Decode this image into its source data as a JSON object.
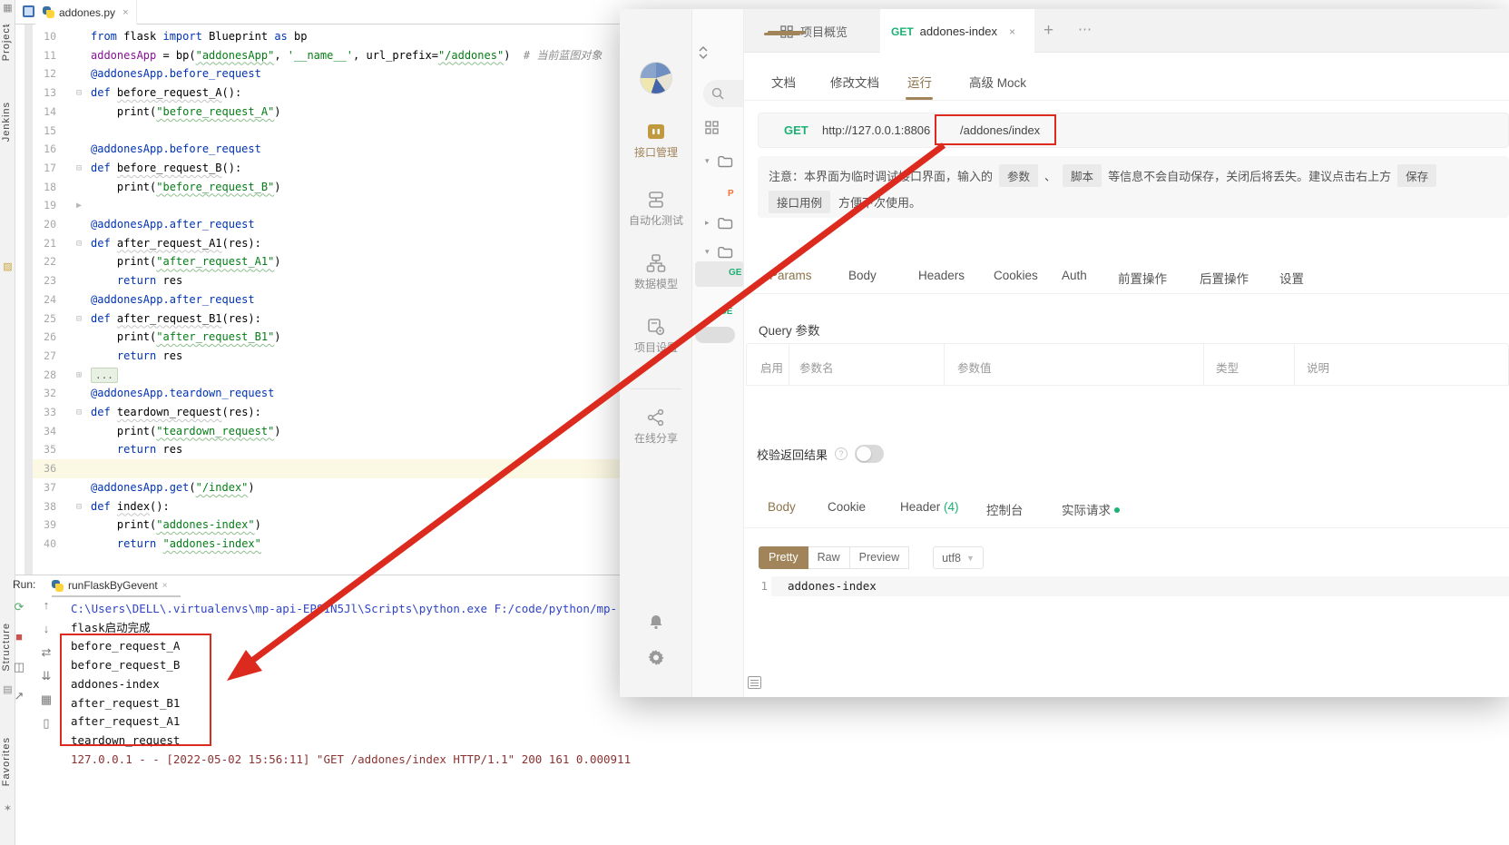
{
  "theme": {
    "accent": "#A2845A",
    "method_green": "#1CB273",
    "annotation_red": "#DC2A1E"
  },
  "ide": {
    "stripe_labels": [
      "Project",
      "Jenkins",
      "Structure",
      "Favorites"
    ],
    "editor_tab": {
      "title": "addones.py",
      "close": "×"
    },
    "code": {
      "current_line": 36,
      "lines": [
        {
          "n": 10,
          "t": [
            [
              "k",
              "from"
            ],
            [
              "t",
              " flask "
            ],
            [
              "k",
              "import"
            ],
            [
              "t",
              " Blueprint "
            ],
            [
              "k",
              "as"
            ],
            [
              "t",
              " bp"
            ]
          ]
        },
        {
          "n": 11,
          "t": [
            [
              "v",
              "addonesApp"
            ],
            [
              "t",
              " = bp("
            ],
            [
              "u",
              "\"addonesApp\""
            ],
            [
              "t",
              ", "
            ],
            [
              "s",
              "'__name__'"
            ],
            [
              "t",
              ", url_prefix="
            ],
            [
              "u",
              "\"/addones\""
            ],
            [
              "t",
              ")  "
            ],
            [
              "c",
              "# 当前蓝图对象"
            ]
          ]
        },
        {
          "n": 12,
          "t": [
            [
              "k",
              "@addonesApp.before_request"
            ]
          ]
        },
        {
          "n": 13,
          "m": "⊟",
          "t": [
            [
              "k",
              "def"
            ],
            [
              "t",
              " "
            ],
            [
              "w",
              "before_request_A"
            ],
            [
              "t",
              "():"
            ]
          ]
        },
        {
          "n": 14,
          "t": [
            [
              "t",
              "    print("
            ],
            [
              "u",
              "\"before_request_A\""
            ],
            [
              "t",
              ")"
            ]
          ]
        },
        {
          "n": 15,
          "t": []
        },
        {
          "n": 16,
          "t": [
            [
              "k",
              "@addonesApp.before_request"
            ]
          ]
        },
        {
          "n": 17,
          "m": "⊟",
          "t": [
            [
              "k",
              "def"
            ],
            [
              "t",
              " "
            ],
            [
              "w",
              "before_request_B"
            ],
            [
              "t",
              "():"
            ]
          ]
        },
        {
          "n": 18,
          "t": [
            [
              "t",
              "    print("
            ],
            [
              "u",
              "\"before_request_B\""
            ],
            [
              "t",
              ")"
            ]
          ]
        },
        {
          "n": 19,
          "m": "▶",
          "t": []
        },
        {
          "n": 20,
          "t": [
            [
              "k",
              "@addonesApp.after_request"
            ]
          ]
        },
        {
          "n": 21,
          "m": "⊟",
          "t": [
            [
              "k",
              "def"
            ],
            [
              "t",
              " "
            ],
            [
              "w",
              "after_request_A1"
            ],
            [
              "t",
              "(res):"
            ]
          ]
        },
        {
          "n": 22,
          "t": [
            [
              "t",
              "    print("
            ],
            [
              "u",
              "\"after_request_A1\""
            ],
            [
              "t",
              ")"
            ]
          ]
        },
        {
          "n": 23,
          "t": [
            [
              "t",
              "    "
            ],
            [
              "k",
              "return"
            ],
            [
              "t",
              " res"
            ]
          ]
        },
        {
          "n": 24,
          "t": [
            [
              "k",
              "@addonesApp.after_request"
            ]
          ]
        },
        {
          "n": 25,
          "m": "⊟",
          "t": [
            [
              "k",
              "def"
            ],
            [
              "t",
              " "
            ],
            [
              "w",
              "after_request_B1"
            ],
            [
              "t",
              "(res):"
            ]
          ]
        },
        {
          "n": 26,
          "t": [
            [
              "t",
              "    print("
            ],
            [
              "u",
              "\"after_request_B1\""
            ],
            [
              "t",
              ")"
            ]
          ]
        },
        {
          "n": 27,
          "t": [
            [
              "t",
              "    "
            ],
            [
              "k",
              "return"
            ],
            [
              "t",
              " res"
            ]
          ]
        },
        {
          "n": 28,
          "m": "⊞",
          "t": [
            [
              "f",
              "..."
            ]
          ]
        },
        {
          "n": 32,
          "t": [
            [
              "k",
              "@addonesApp.teardown_request"
            ]
          ]
        },
        {
          "n": 33,
          "m": "⊟",
          "t": [
            [
              "k",
              "def"
            ],
            [
              "t",
              " "
            ],
            [
              "w",
              "teardown_request"
            ],
            [
              "t",
              "(res):"
            ]
          ]
        },
        {
          "n": 34,
          "t": [
            [
              "t",
              "    print("
            ],
            [
              "u",
              "\"teardown_request\""
            ],
            [
              "t",
              ")"
            ]
          ]
        },
        {
          "n": 35,
          "t": [
            [
              "t",
              "    "
            ],
            [
              "k",
              "return"
            ],
            [
              "t",
              " res"
            ]
          ]
        },
        {
          "n": 36,
          "t": []
        },
        {
          "n": 37,
          "t": [
            [
              "k",
              "@addonesApp.get"
            ],
            [
              "t",
              "("
            ],
            [
              "u",
              "\"/index\""
            ],
            [
              "t",
              ")"
            ]
          ]
        },
        {
          "n": 38,
          "m": "⊟",
          "t": [
            [
              "k",
              "def"
            ],
            [
              "t",
              " "
            ],
            [
              "w",
              "index"
            ],
            [
              "t",
              "():"
            ]
          ]
        },
        {
          "n": 39,
          "t": [
            [
              "t",
              "    print("
            ],
            [
              "u",
              "\"addones-index\""
            ],
            [
              "t",
              ")"
            ]
          ]
        },
        {
          "n": 40,
          "t": [
            [
              "t",
              "    "
            ],
            [
              "k",
              "return"
            ],
            [
              "t",
              " "
            ],
            [
              "u",
              "\"addones-index\""
            ]
          ]
        }
      ]
    },
    "run": {
      "label": "Run:",
      "tab": {
        "title": "runFlaskByGevent",
        "close": "×"
      },
      "console": [
        {
          "c": "sys",
          "t": "C:\\Users\\DELL\\.virtualenvs\\mp-api-EP81N5Jl\\Scripts\\python.exe F:/code/python/mp-"
        },
        {
          "c": "out",
          "t": "flask启动完成"
        },
        {
          "c": "out",
          "t": "before_request_A"
        },
        {
          "c": "out",
          "t": "before_request_B"
        },
        {
          "c": "out",
          "t": "addones-index"
        },
        {
          "c": "out",
          "t": "after_request_B1"
        },
        {
          "c": "out",
          "t": "after_request_A1"
        },
        {
          "c": "out",
          "t": "teardown_request"
        },
        {
          "c": "err",
          "t": "127.0.0.1 - - [2022-05-02 15:56:11] \"GET /addones/index HTTP/1.1\" 200 161 0.000911"
        }
      ]
    }
  },
  "api": {
    "window_tabs": {
      "overview_label": "项目概览",
      "active": {
        "method": "GET",
        "name": "addones-index",
        "close": "×"
      },
      "plus": "+",
      "more": "⋯"
    },
    "sidebar": {
      "items": [
        {
          "label": "接口管理",
          "icon": "api-manage-icon",
          "active": true
        },
        {
          "label": "自动化测试",
          "icon": "automation-test-icon",
          "active": false
        },
        {
          "label": "数据模型",
          "icon": "data-model-icon",
          "active": false
        },
        {
          "label": "项目设置",
          "icon": "project-settings-icon",
          "active": false
        },
        {
          "label": "在线分享",
          "icon": "share-icon",
          "active": false
        }
      ]
    },
    "subtabs": {
      "items": [
        "文档",
        "修改文档",
        "运行",
        "高级 Mock"
      ],
      "active_index": 2
    },
    "url": {
      "method": "GET",
      "base": "http://127.0.0.1:8806",
      "path": "/addones/index"
    },
    "notice": {
      "line1": [
        "注意：本界面为临时调试接口界面，输入的",
        "参数",
        "、",
        "脚本",
        "等信息不会自动保存，关闭后将丢失。建议点击右上方",
        "保存"
      ],
      "line2_chip": "接口用例",
      "line2_text": "方便下次使用。"
    },
    "request_tabs": {
      "items": [
        "Params",
        "Body",
        "Headers",
        "Cookies",
        "Auth",
        "前置操作",
        "后置操作",
        "设置"
      ],
      "active_index": 0
    },
    "query_section": {
      "title": "Query 参数",
      "columns": [
        "启用",
        "参数名",
        "参数值",
        "类型",
        "说明"
      ]
    },
    "validate": {
      "label": "校验返回结果",
      "help": "?",
      "enabled": false
    },
    "response_tabs": {
      "items": [
        {
          "label": "Body"
        },
        {
          "label": "Cookie"
        },
        {
          "label": "Header",
          "count": "(4)"
        },
        {
          "label": "控制台"
        },
        {
          "label": "实际请求",
          "dot": true
        }
      ],
      "active_index": 0
    },
    "view_modes": {
      "items": [
        "Pretty",
        "Raw",
        "Preview"
      ],
      "active_index": 0,
      "encoding": "utf8"
    },
    "response": {
      "line_no": "1",
      "body": "addones-index"
    }
  }
}
